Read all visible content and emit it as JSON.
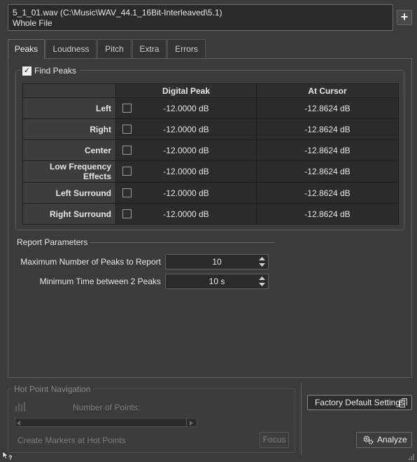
{
  "file": {
    "line1": "5_1_01.wav (C:\\Music\\WAV_44.1_16Bit-Interleaved\\5.1)",
    "line2": "Whole File",
    "add_label": "+"
  },
  "tabs": [
    {
      "label": "Peaks",
      "active": true
    },
    {
      "label": "Loudness",
      "active": false
    },
    {
      "label": "Pitch",
      "active": false
    },
    {
      "label": "Extra",
      "active": false
    },
    {
      "label": "Errors",
      "active": false
    }
  ],
  "find_peaks": {
    "label": "Find Peaks",
    "checked": true,
    "columns": [
      "Digital Peak",
      "At Cursor"
    ],
    "rows": [
      {
        "channel": "Left",
        "checked": false,
        "digital_peak": "-12.0000 dB",
        "at_cursor": "-12.8624 dB"
      },
      {
        "channel": "Right",
        "checked": false,
        "digital_peak": "-12.0000 dB",
        "at_cursor": "-12.8624 dB"
      },
      {
        "channel": "Center",
        "checked": false,
        "digital_peak": "-12.0000 dB",
        "at_cursor": "-12.8624 dB"
      },
      {
        "channel": "Low Frequency Effects",
        "checked": false,
        "digital_peak": "-12.0000 dB",
        "at_cursor": "-12.8624 dB"
      },
      {
        "channel": "Left Surround",
        "checked": false,
        "digital_peak": "-12.0000 dB",
        "at_cursor": "-12.8624 dB"
      },
      {
        "channel": "Right Surround",
        "checked": false,
        "digital_peak": "-12.0000 dB",
        "at_cursor": "-12.8624 dB"
      }
    ]
  },
  "report": {
    "title": "Report Parameters",
    "max_peaks_label": "Maximum Number of Peaks to Report",
    "max_peaks_value": "10",
    "min_time_label": "Minimum Time between 2 Peaks",
    "min_time_value": "10 s"
  },
  "hot_point": {
    "title": "Hot Point Navigation",
    "points_label": "Number of Points:",
    "create_markers_label": "Create Markers at Hot Points",
    "focus_label": "Focus"
  },
  "actions": {
    "factory_label": "Factory Default Settings",
    "analyze_label": "Analyze"
  },
  "icons": {
    "add": "plus-icon",
    "factory": "document-icon",
    "analyze": "gears-icon",
    "hot_point": "meter-bars-icon",
    "help": "help-cursor-icon",
    "resize": "resize-grip-icon"
  }
}
